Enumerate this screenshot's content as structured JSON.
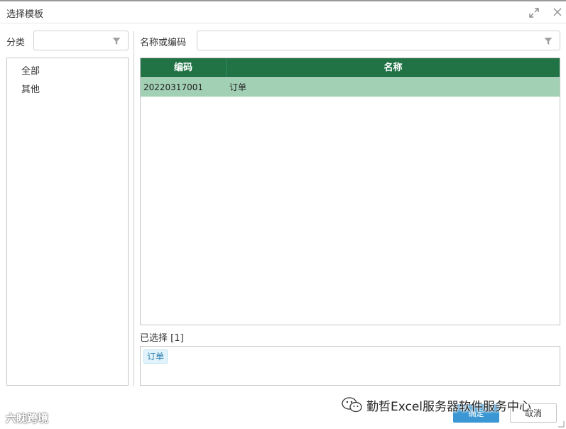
{
  "dialog": {
    "title": "选择模板"
  },
  "category": {
    "label": "分类",
    "filter_value": "",
    "items": [
      {
        "label": "全部"
      },
      {
        "label": "其他"
      }
    ]
  },
  "search": {
    "label": "名称或编码",
    "value": ""
  },
  "grid": {
    "columns": [
      "编码",
      "名称"
    ],
    "rows": [
      {
        "code": "20220317001",
        "name": "订单"
      }
    ]
  },
  "selection": {
    "label": "已选择 [1]",
    "tags": [
      "订单"
    ]
  },
  "buttons": {
    "ok": "确定",
    "cancel": "取消"
  },
  "watermarks": {
    "left": "六眈跨境",
    "right": "勤哲Excel服务器软件服务中心"
  },
  "colors": {
    "header_green": "#217346",
    "row_selected": "#a2d0b4",
    "primary_button": "#3b97d3",
    "tag_bg": "#e3f3fb"
  }
}
